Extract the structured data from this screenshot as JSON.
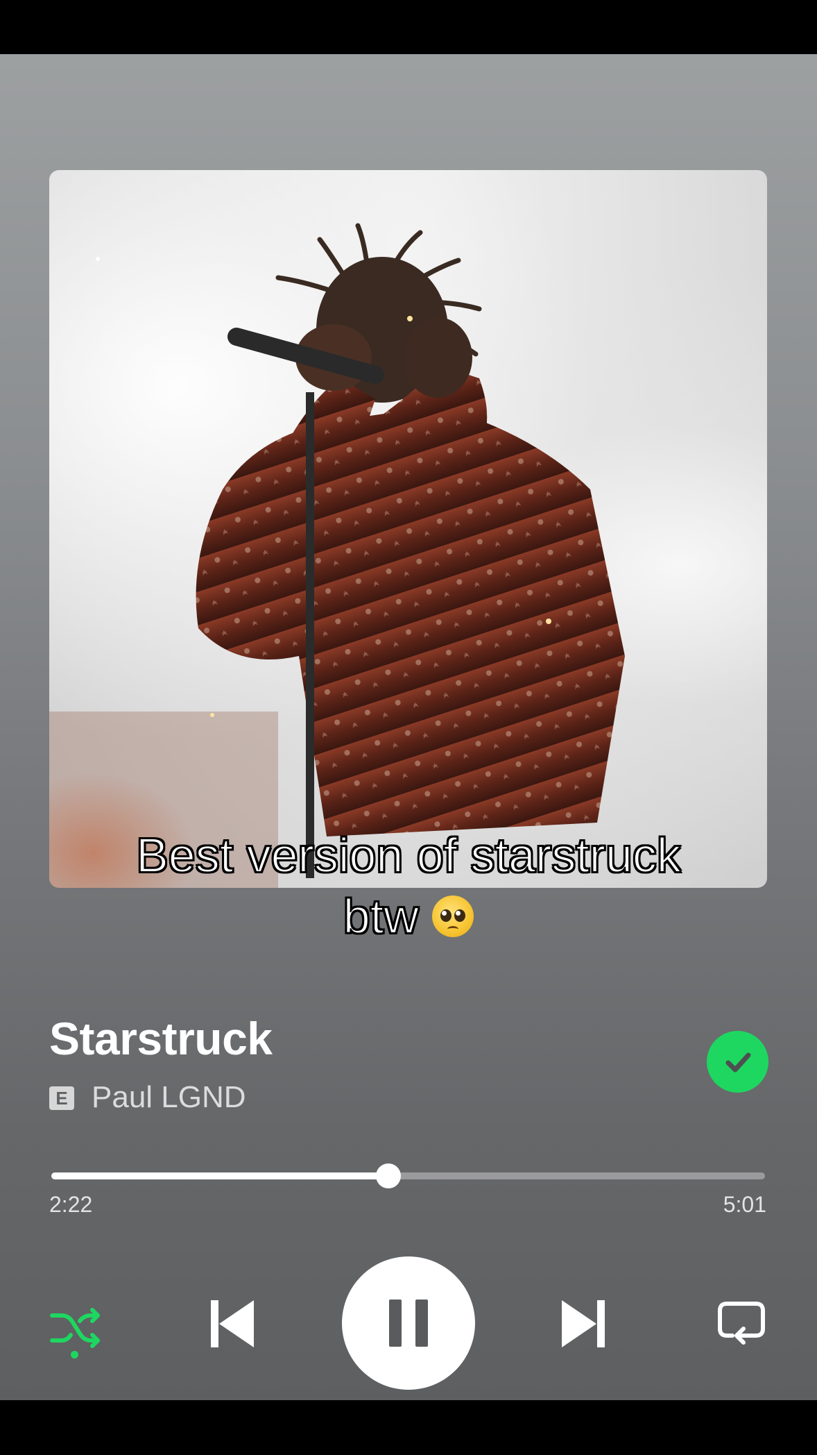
{
  "caption": {
    "line1": "Best version of starstruck",
    "line2": "btw"
  },
  "track": {
    "title": "Starstruck",
    "explicit_badge": "E",
    "artist": "Paul LGND",
    "liked": true
  },
  "playback": {
    "elapsed": "2:22",
    "total": "5:01",
    "progress_fraction": 0.472,
    "state": "playing",
    "shuffle_on": true,
    "repeat_on": false
  },
  "colors": {
    "accent": "#1ed760",
    "text": "#ffffff"
  },
  "icons": {
    "liked": "check-circle-icon",
    "shuffle": "shuffle-icon",
    "previous": "skip-previous-icon",
    "pause": "pause-icon",
    "next": "skip-next-icon",
    "repeat": "repeat-icon"
  }
}
